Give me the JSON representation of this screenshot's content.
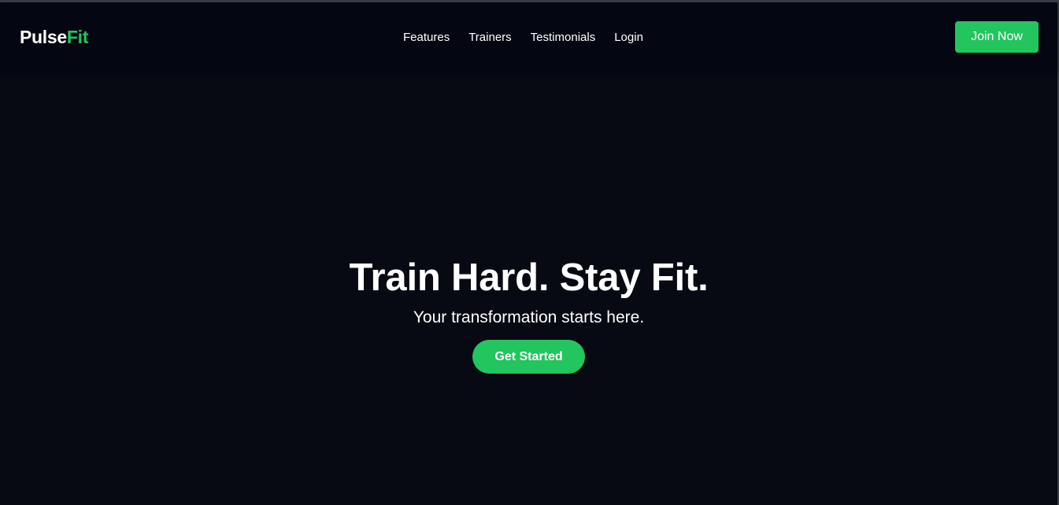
{
  "brand": {
    "name_part1": "Pulse",
    "name_part2": "Fit",
    "accent_color": "#22c55e"
  },
  "nav": {
    "links": [
      {
        "label": "Features"
      },
      {
        "label": "Trainers"
      },
      {
        "label": "Testimonials"
      },
      {
        "label": "Login"
      }
    ],
    "join_label": "Join Now"
  },
  "hero": {
    "title": "Train Hard. Stay Fit.",
    "subtitle": "Your transformation starts here.",
    "cta_label": "Get Started"
  },
  "colors": {
    "background": "#070a12",
    "navbar_background": "#040711",
    "text": "#ffffff",
    "accent": "#22c55e"
  }
}
